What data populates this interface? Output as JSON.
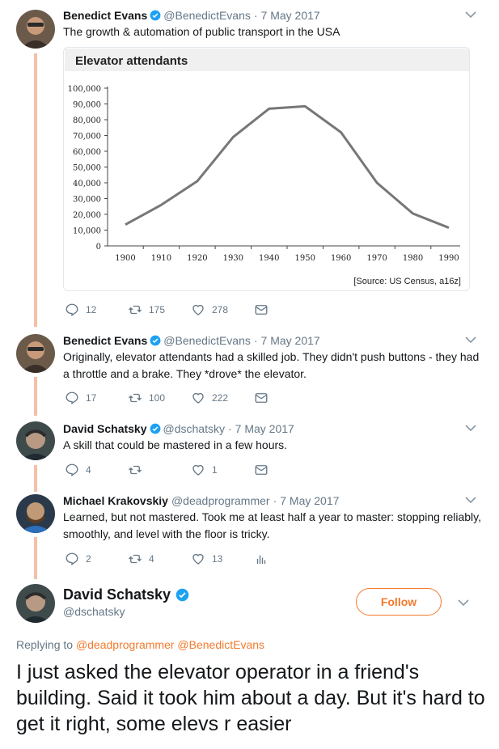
{
  "tweets": [
    {
      "name": "Benedict Evans",
      "handle": "@BenedictEvans",
      "date": "7 May 2017",
      "text": "The growth & automation of public transport in the USA",
      "replies": "12",
      "retweets": "175",
      "likes": "278"
    },
    {
      "name": "Benedict Evans",
      "handle": "@BenedictEvans",
      "date": "7 May 2017",
      "text": "Originally, elevator attendants had a skilled job. They didn't push buttons - they had a throttle and a brake. They *drove* the elevator.",
      "replies": "17",
      "retweets": "100",
      "likes": "222"
    },
    {
      "name": "David Schatsky",
      "handle": "@dschatsky",
      "date": "7 May 2017",
      "text": "A skill that could be mastered in a few hours.",
      "replies": "4",
      "retweets": "",
      "likes": "1"
    },
    {
      "name": "Michael Krakovskiy",
      "handle": "@deadprogrammer",
      "date": "7 May 2017",
      "text": "Learned, but not mastered. Took me at least half a year to master: stopping reliably, smoothly, and level with the floor is tricky.",
      "replies": "2",
      "retweets": "4",
      "likes": "13"
    }
  ],
  "separator": "·",
  "chart_data": {
    "type": "line",
    "title": "Elevator attendants",
    "source": "[Source: US Census, a16z]",
    "categories": [
      "1900",
      "1910",
      "1920",
      "1930",
      "1940",
      "1950",
      "1960",
      "1970",
      "1980",
      "1990"
    ],
    "y_ticks": [
      "0",
      "10,000",
      "20,000",
      "30,000",
      "40,000",
      "50,000",
      "60,000",
      "70,000",
      "80,000",
      "90,000",
      "100,000"
    ],
    "values": [
      13500,
      26000,
      41000,
      69000,
      87000,
      88500,
      72000,
      40000,
      20500,
      11500
    ],
    "ylim": [
      0,
      100000
    ],
    "grid": false,
    "line_color": "#777777"
  },
  "main_tweet": {
    "name": "David Schatsky",
    "handle": "@dschatsky",
    "follow_label": "Follow",
    "replying_prefix": "Replying to",
    "replying_mentions": "@deadprogrammer @BenedictEvans",
    "text": "I just asked the elevator operator in a friend's building. Said it took him about a day. But it's hard to get it right, some elevs r easier"
  },
  "colors": {
    "accent": "#f47a2c",
    "verified": "#1da1f2",
    "thread_line": "#f5c0a8",
    "muted": "#657786"
  }
}
